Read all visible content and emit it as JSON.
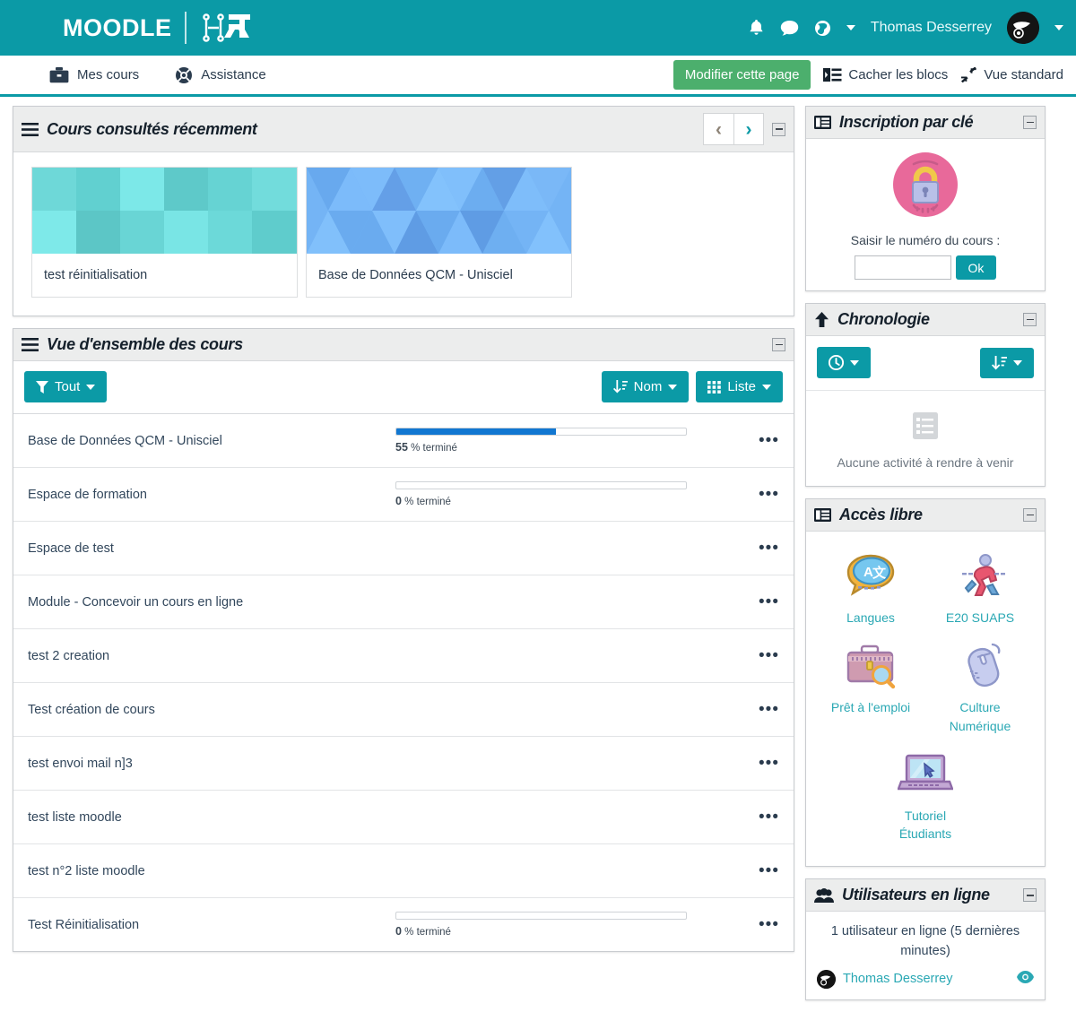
{
  "header": {
    "brand_word": "MOODLE",
    "brand_mark": "uha-logo-icon",
    "user_name": "Thomas Desserrey",
    "icons": [
      "bell-icon",
      "chat-icon",
      "globe-icon",
      "avatar",
      "chevron-down-icon"
    ]
  },
  "nav": {
    "items": [
      {
        "label": "Mes cours",
        "icon": "briefcase-icon"
      },
      {
        "label": "Assistance",
        "icon": "lifebuoy-icon"
      }
    ],
    "edit_button": "Modifier cette page",
    "hide_blocks": "Cacher les blocs",
    "standard_view": "Vue standard"
  },
  "recent_courses": {
    "title": "Cours consultés récemment",
    "prev": "‹",
    "next": "›",
    "cards": [
      {
        "name": "test réinitialisation",
        "pattern": "teal-squares"
      },
      {
        "name": "Base de Données QCM - Unisciel",
        "pattern": "blue-triangles"
      }
    ]
  },
  "course_overview": {
    "title": "Vue d'ensemble des cours",
    "filter_label": "Tout",
    "sort_label": "Nom",
    "view_label": "Liste",
    "percent_suffix": "% terminé",
    "courses": [
      {
        "name": "Base de Données QCM - Unisciel",
        "progress": 55,
        "has_progress": true
      },
      {
        "name": "Espace de formation",
        "progress": 0,
        "has_progress": true
      },
      {
        "name": "Espace de test",
        "progress": null,
        "has_progress": false
      },
      {
        "name": "Module - Concevoir un cours en ligne",
        "progress": null,
        "has_progress": false
      },
      {
        "name": "test 2 creation",
        "progress": null,
        "has_progress": false
      },
      {
        "name": "Test création de cours",
        "progress": null,
        "has_progress": false
      },
      {
        "name": "test envoi mail n]3",
        "progress": null,
        "has_progress": false
      },
      {
        "name": "test liste moodle",
        "progress": null,
        "has_progress": false
      },
      {
        "name": "test n°2 liste moodle",
        "progress": null,
        "has_progress": false
      },
      {
        "name": "Test Réinitialisation",
        "progress": 0,
        "has_progress": true
      }
    ]
  },
  "enrolment_key": {
    "title": "Inscription par clé",
    "icon": "padlock-icon",
    "prompt": "Saisir le numéro du cours :",
    "input_value": "",
    "input_placeholder": "",
    "ok_label": "Ok"
  },
  "timeline": {
    "title": "Chronologie",
    "date_filter_icon": "clock-icon",
    "sort_icon": "sort-icon",
    "empty_icon": "list-icon",
    "empty_text": "Aucune activité à rendre à venir"
  },
  "free_access": {
    "title": "Accès libre",
    "items": [
      {
        "label": "Langues",
        "icon": "translate-icon"
      },
      {
        "label": "E20 SUAPS",
        "icon": "runner-icon"
      },
      {
        "label": "Prêt à l'emploi",
        "icon": "briefcase-search-icon"
      },
      {
        "label": "Culture Numérique",
        "icon": "mouse-icon"
      },
      {
        "label": "Tutoriel Étudiants",
        "icon": "laptop-icon"
      }
    ]
  },
  "online_users": {
    "title": "Utilisateurs en ligne",
    "count_text": "1 utilisateur en ligne (5 dernières minutes)",
    "user_name": "Thomas Desserrey",
    "eye_icon": "eye-icon"
  },
  "colors": {
    "teal": "#0b9aa6",
    "green": "#4caf6d",
    "progress_blue": "#1177d1",
    "link_teal": "#2aa8b4",
    "block_header": "#eceded"
  }
}
